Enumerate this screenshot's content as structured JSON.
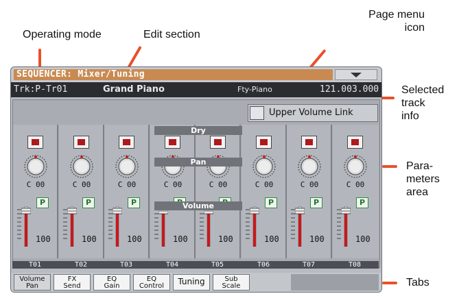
{
  "annotations": {
    "operating_mode": "Operating mode",
    "edit_section": "Edit section",
    "page_menu_icon_l1": "Page menu",
    "page_menu_icon_l2": "icon",
    "selected_track_l1": "Selected",
    "selected_track_l2": "track",
    "selected_track_l3": "info",
    "params_l1": "Para-",
    "params_l2": "meters",
    "params_l3": "area",
    "tabs": "Tabs"
  },
  "title": "SEQUENCER: Mixer/Tuning",
  "track_info": {
    "track": "Trk:P-Tr01",
    "program": "Grand Piano",
    "bank": "Fty-Piano",
    "position": "121.003.000"
  },
  "upper_volume_link": "Upper Volume Link",
  "section_labels": {
    "dry": "Dry",
    "pan": "Pan",
    "volume": "Volume"
  },
  "tracks": [
    {
      "name": "T01",
      "pan": "C 00",
      "volume": "100",
      "play": "P"
    },
    {
      "name": "T02",
      "pan": "C 00",
      "volume": "100",
      "play": "P"
    },
    {
      "name": "T03",
      "pan": "C 00",
      "volume": "100",
      "play": "P"
    },
    {
      "name": "T04",
      "pan": "C 00",
      "volume": "100",
      "play": "P"
    },
    {
      "name": "T05",
      "pan": "C 00",
      "volume": "100",
      "play": "P"
    },
    {
      "name": "T06",
      "pan": "C 00",
      "volume": "100",
      "play": "P"
    },
    {
      "name": "T07",
      "pan": "C 00",
      "volume": "100",
      "play": "P"
    },
    {
      "name": "T08",
      "pan": "C 00",
      "volume": "100",
      "play": "P"
    }
  ],
  "tabs": [
    {
      "l1": "Volume",
      "l2": "Pan"
    },
    {
      "l1": "FX",
      "l2": "Send"
    },
    {
      "l1": "EQ",
      "l2": "Gain"
    },
    {
      "l1": "EQ",
      "l2": "Control"
    },
    {
      "l1": "Tuning",
      "l2": ""
    },
    {
      "l1": "Sub",
      "l2": "Scale"
    }
  ],
  "colors": {
    "accent": "#e8502a",
    "title_bar": "#c98a52",
    "mute_indicator": "#b0181c",
    "play_green": "#2f8a3a"
  }
}
